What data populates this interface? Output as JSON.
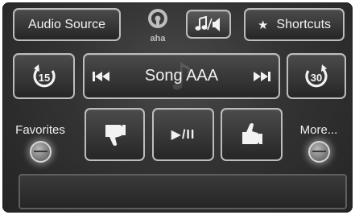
{
  "header": {
    "audio_source_label": "Audio Source",
    "shortcuts_label": "Shortcuts",
    "shortcuts_star": "★",
    "logo_text": "aha"
  },
  "transport": {
    "skip_back_seconds": "15",
    "skip_forward_seconds": "30",
    "song_title": "Song AAA",
    "prev_icon": "skip-previous-icon",
    "next_icon": "skip-next-icon"
  },
  "actions": {
    "play_pause_label": "▶/II",
    "thumb_down_icon": "thumbs-down-icon",
    "thumb_up_icon": "thumbs-up-icon"
  },
  "side_keys": {
    "favorites_label": "Favorites",
    "more_label": "More..."
  },
  "colors": {
    "background": "#2e2e2e",
    "button_border": "#bdbdbd",
    "text": "#f2f2f2"
  }
}
